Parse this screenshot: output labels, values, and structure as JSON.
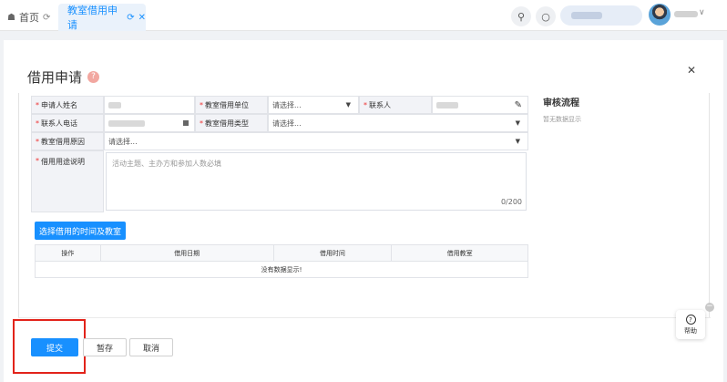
{
  "tabs": {
    "home": "首页",
    "active": "教室借用申请"
  },
  "header": {
    "icons": [
      "search-icon",
      "shirt-icon"
    ]
  },
  "page": {
    "title": "借用申请"
  },
  "form": {
    "applicant_name_label": "申请人姓名",
    "unit_label": "教室借用单位",
    "unit_placeholder": "请选择...",
    "contact_label": "联系人",
    "contact_phone_label": "联系人电话",
    "type_label": "教室借用类型",
    "type_placeholder": "请选择...",
    "reason_label": "教室借用原因",
    "reason_placeholder": "请选择...",
    "purpose_label": "借用用途说明",
    "purpose_placeholder": "活动主题、主办方和参加人数必填",
    "purpose_counter": "0/200"
  },
  "time_room": {
    "button": "选择借用的时间及教室",
    "columns": [
      "操作",
      "借用日期",
      "借用时间",
      "借用教室"
    ],
    "empty": "没有数据显示!"
  },
  "audit": {
    "title": "审核流程",
    "empty": "暂无数据显示"
  },
  "actions": {
    "submit": "提交",
    "save": "暂存",
    "cancel": "取消"
  },
  "help": {
    "label": "帮助"
  },
  "colors": {
    "accent": "#1890ff",
    "highlight": "#e2231a"
  }
}
